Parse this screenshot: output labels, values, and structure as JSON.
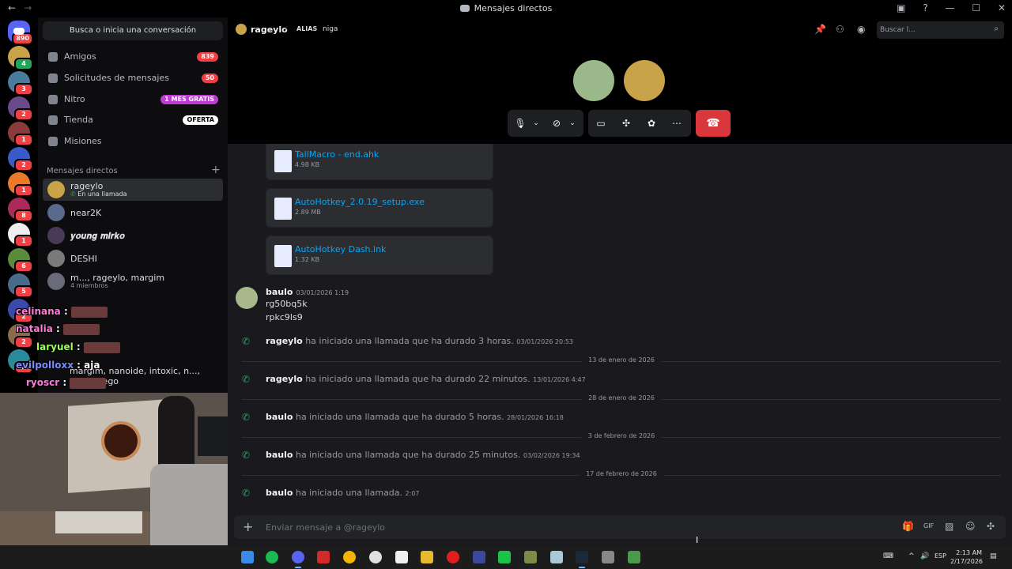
{
  "window": {
    "title": "Mensajes directos"
  },
  "servers": [
    {
      "badge": "890"
    },
    {
      "badge": "4"
    },
    {
      "badge": "3"
    },
    {
      "badge": "2"
    },
    {
      "badge": "1"
    },
    {
      "badge": "2"
    },
    {
      "badge": "1"
    },
    {
      "badge": "8"
    },
    {
      "badge": "1"
    },
    {
      "badge": "6"
    },
    {
      "badge": "5"
    },
    {
      "badge": "2"
    },
    {
      "badge": "2"
    },
    {
      "badge": "2"
    }
  ],
  "sidebar": {
    "search_label": "Busca o inicia una conversación",
    "nav": [
      {
        "label": "Amigos",
        "badge": "839"
      },
      {
        "label": "Solicitudes de mensajes",
        "badge": "50"
      },
      {
        "label": "Nitro",
        "badge": "1 MES GRATIS"
      },
      {
        "label": "Tienda",
        "badge": "OFERTA"
      },
      {
        "label": "Misiones",
        "badge": ""
      }
    ],
    "dm_header": "Mensajes directos",
    "dms": [
      {
        "name": "rageylo",
        "sub": "En una llamada"
      },
      {
        "name": "near2K",
        "sub": ""
      },
      {
        "name": "𝒚𝒐𝒖𝒏𝒈 𝒎𝒊𝒓𝒌𝒐",
        "sub": ""
      },
      {
        "name": "DESHI",
        "sub": ""
      },
      {
        "name": "m..., rageylo, margim",
        "sub": "4 miembros"
      },
      {
        "name": "margim, nanoide, intoxic, n..., tupapiyego",
        "sub": ""
      }
    ]
  },
  "overlay_chat": [
    {
      "user": "celinana",
      "msg": "",
      "color": "#ff7ad9"
    },
    {
      "user": "natalia",
      "msg": "",
      "color": "#ff7ad9"
    },
    {
      "user": "laryuel",
      "msg": "",
      "color": "#9cff57"
    },
    {
      "user": "evilpolloxx",
      "msg": "aja",
      "color": "#7a8cff"
    },
    {
      "user": "ryoscr",
      "msg": "",
      "color": "#ff7ad9"
    }
  ],
  "header": {
    "username": "rageylo",
    "alias_label": "ALIAS",
    "alias_value": "niga",
    "search_placeholder": "Buscar l..."
  },
  "messages": {
    "files": [
      {
        "name": "TallMacro - end.ahk",
        "size": "4.98 KB"
      },
      {
        "name": "AutoHotkey_2.0.19_setup.exe",
        "size": "2.89 MB"
      },
      {
        "name": "AutoHotkey Dash.lnk",
        "size": "1.32 KB"
      }
    ],
    "post": {
      "author": "baulo",
      "time": "03/01/2026 1:19",
      "lines": [
        "rg50bq5k",
        "rpkc9ls9"
      ]
    },
    "calls": [
      {
        "user": "rageylo",
        "text": "ha iniciado una llamada que ha durado 3 horas.",
        "time": "03/01/2026 20:53"
      },
      {
        "user": "rageylo",
        "text": "ha iniciado una llamada que ha durado 22 minutos.",
        "time": "13/01/2026 4:47"
      },
      {
        "user": "baulo",
        "text": "ha iniciado una llamada que ha durado 5 horas.",
        "time": "28/01/2026 16:18"
      },
      {
        "user": "baulo",
        "text": "ha iniciado una llamada que ha durado 25 minutos.",
        "time": "03/02/2026 19:34"
      },
      {
        "user": "baulo",
        "text": "ha iniciado una llamada.",
        "time": "2:07"
      }
    ],
    "dividers": [
      "13 de enero de 2026",
      "28 de enero de 2026",
      "3 de febrero de 2026",
      "17 de febrero de 2026"
    ]
  },
  "composer": {
    "placeholder": "Enviar mensaje a @rageylo"
  },
  "taskbar": {
    "lang": "ESP",
    "time": "2:13 AM",
    "date": "2/17/2026"
  },
  "colors": {
    "accent": "#5865f2",
    "danger": "#da373c",
    "online": "#23a55a",
    "link": "#00a8fc"
  }
}
